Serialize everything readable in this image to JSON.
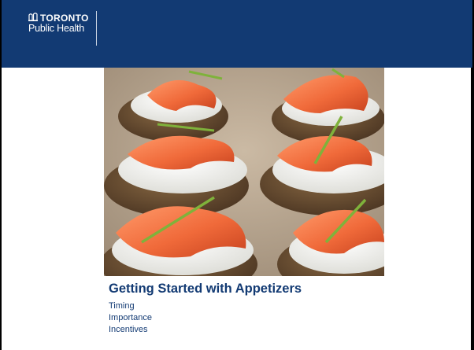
{
  "logo": {
    "line1": "TORONTO",
    "line2": "Public Health",
    "icon": "city-hall-icon"
  },
  "colors": {
    "brand_blue": "#123a73",
    "background": "#ffffff"
  },
  "image": {
    "subject": "salmon-appetizer-photo"
  },
  "content": {
    "title": "Getting Started with Appetizers",
    "items": [
      "Timing",
      "Importance",
      "Incentives"
    ]
  }
}
